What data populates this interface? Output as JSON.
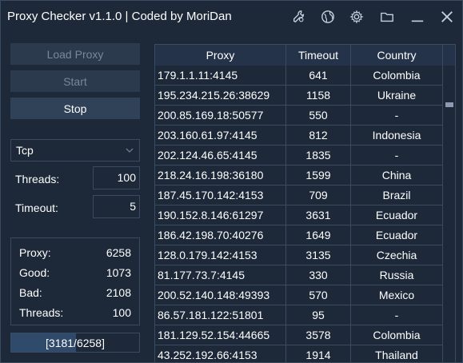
{
  "app": {
    "title": "Proxy Checker v1.1.0 | Coded by MoriDan"
  },
  "titlebar_icons": [
    "wrench-icon",
    "globe-icon",
    "gear-icon",
    "folder-icon",
    "minimize-icon",
    "close-icon"
  ],
  "buttons": {
    "load": "Load Proxy",
    "start": "Start",
    "stop": "Stop"
  },
  "protocol": {
    "selected": "Tcp"
  },
  "threads": {
    "label": "Threads:",
    "value": "100"
  },
  "timeout": {
    "label": "Timeout:",
    "value": "5"
  },
  "stats": {
    "proxy_label": "Proxy:",
    "proxy_value": "6258",
    "good_label": "Good:",
    "good_value": "1073",
    "bad_label": "Bad:",
    "bad_value": "2108",
    "threads_label": "Threads:",
    "threads_value": "100"
  },
  "progress": {
    "text": "[3181/6258]",
    "fraction": 0.508
  },
  "table": {
    "headers": {
      "proxy": "Proxy",
      "timeout": "Timeout",
      "country": "Country"
    },
    "rows": [
      {
        "proxy": "179.1.1.11:4145",
        "timeout": "641",
        "country": "Colombia"
      },
      {
        "proxy": "195.234.215.26:38629",
        "timeout": "1158",
        "country": "Ukraine"
      },
      {
        "proxy": "200.85.169.18:50577",
        "timeout": "550",
        "country": "-"
      },
      {
        "proxy": "203.160.61.97:4145",
        "timeout": "812",
        "country": "Indonesia"
      },
      {
        "proxy": "202.124.46.65:4145",
        "timeout": "1835",
        "country": "-"
      },
      {
        "proxy": "218.24.16.198:36180",
        "timeout": "1599",
        "country": "China"
      },
      {
        "proxy": "187.45.170.142:4153",
        "timeout": "709",
        "country": "Brazil"
      },
      {
        "proxy": "190.152.8.146:61297",
        "timeout": "3631",
        "country": "Ecuador"
      },
      {
        "proxy": "186.42.198.70:40276",
        "timeout": "1649",
        "country": "Ecuador"
      },
      {
        "proxy": "128.0.179.142:4153",
        "timeout": "3135",
        "country": "Czechia"
      },
      {
        "proxy": "81.177.73.7:4145",
        "timeout": "330",
        "country": "Russia"
      },
      {
        "proxy": "200.52.140.148:49393",
        "timeout": "570",
        "country": "Mexico"
      },
      {
        "proxy": "86.57.181.122:51801",
        "timeout": "95",
        "country": "-"
      },
      {
        "proxy": "181.129.52.154:44665",
        "timeout": "3578",
        "country": "Colombia"
      },
      {
        "proxy": "43.252.192.66:4153",
        "timeout": "1914",
        "country": "Thailand"
      }
    ]
  }
}
